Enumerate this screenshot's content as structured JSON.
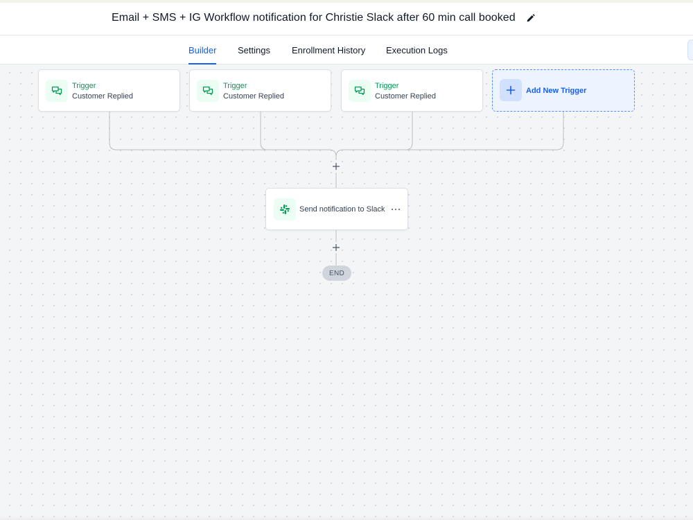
{
  "workflow": {
    "title": "Email + SMS + IG Workflow notification for Christie Slack after 60 min call booked",
    "edit_icon": "pencil-icon"
  },
  "tabs": [
    {
      "label": "Builder",
      "active": true
    },
    {
      "label": "Settings",
      "active": false
    },
    {
      "label": "Enrollment History",
      "active": false
    },
    {
      "label": "Execution Logs",
      "active": false
    }
  ],
  "triggers": [
    {
      "type": "Trigger",
      "event": "Customer Replied",
      "icon": "chat-bubbles-icon"
    },
    {
      "type": "Trigger",
      "event": "Customer Replied",
      "icon": "chat-bubbles-icon"
    },
    {
      "type": "Trigger",
      "event": "Customer Replied",
      "icon": "chat-bubbles-icon"
    }
  ],
  "add_trigger": {
    "label": "Add New Trigger",
    "icon": "plus-icon"
  },
  "actions": [
    {
      "label": "Send notification to Slack",
      "icon": "slack-icon",
      "menu_icon": "more-horizontal-icon"
    }
  ],
  "end": {
    "label": "END"
  },
  "colors": {
    "accent": "#155eef",
    "trigger_green": "#039855",
    "trigger_icon_bg": "#ecfdf3",
    "add_trigger_bg": "#eef4ff"
  }
}
